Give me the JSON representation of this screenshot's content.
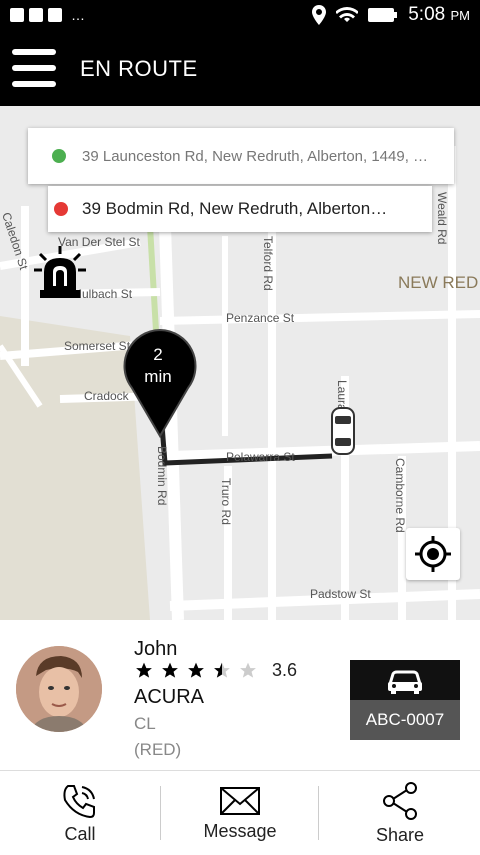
{
  "status_bar": {
    "icons": [
      "facebook-icon",
      "facebook-icon",
      "image-icon"
    ],
    "overflow": "…",
    "time": "5:08",
    "ampm": "PM"
  },
  "app_bar": {
    "title": "EN ROUTE",
    "menu_icon": "menu-icon"
  },
  "map": {
    "pickup_address": "39 Launceston Rd, New Redruth, Alberton, 1449, …",
    "dropoff_address": "39 Bodmin Rd, New Redruth, Alberton…",
    "pickup_color": "#4caf50",
    "dropoff_color": "#e53935",
    "eta_value": "2",
    "eta_unit": "min",
    "streets": {
      "launceston": "Launceston Rd",
      "van_der_stel": "Van Der Stel St",
      "caledon": "Caledon St",
      "mulbach": "Mulbach St",
      "somerset": "Somerset St",
      "cradock": "Cradock",
      "penzance": "Penzance St",
      "telford": "Telford Rd",
      "wealdrd": "Weald Rd",
      "area": "NEW RED",
      "bodmin": "Bodmin Rd",
      "pelawarra": "Pelawarra St",
      "truro": "Truro Rd",
      "camborne": "Camborne Rd",
      "padstow": "Padstow St",
      "laura": "Laura"
    }
  },
  "driver": {
    "name": "John",
    "rating": "3.6",
    "rating_value": 3.6,
    "car_make": "ACURA",
    "car_model": "CL",
    "car_color": "(RED)",
    "plate": "ABC-0007"
  },
  "actions": [
    {
      "label": "Call",
      "icon": "phone-icon"
    },
    {
      "label": "Message",
      "icon": "envelope-icon"
    },
    {
      "label": "Share",
      "icon": "share-icon"
    }
  ]
}
